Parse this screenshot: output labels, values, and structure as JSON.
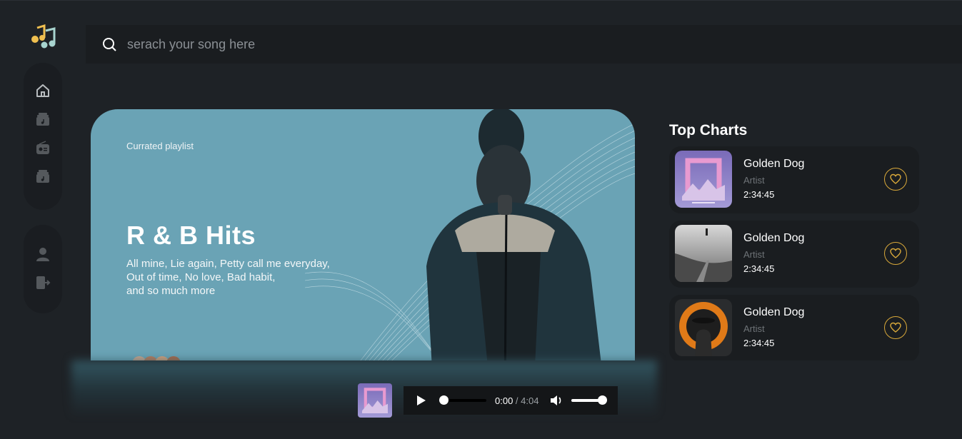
{
  "app": {
    "logo_icon": "music-notes-icon"
  },
  "search": {
    "placeholder": "serach your song here",
    "icon": "search-icon"
  },
  "sidebar": {
    "top_items": [
      {
        "icon": "home-icon"
      },
      {
        "icon": "music-library-icon"
      },
      {
        "icon": "radio-icon"
      },
      {
        "icon": "music-library-icon"
      }
    ],
    "bottom_items": [
      {
        "icon": "user-icon"
      },
      {
        "icon": "logout-icon"
      }
    ]
  },
  "hero": {
    "label": "Currated playlist",
    "title": "R & B Hits",
    "description_lines": [
      "All mine, Lie again, Petty call me everyday,",
      "Out of time, No love, Bad habit,",
      "and so much more"
    ]
  },
  "top_charts": {
    "title": "Top Charts",
    "items": [
      {
        "song": "Golden Dog",
        "artist": "Artist",
        "duration": "2:34:45"
      },
      {
        "song": "Golden Dog",
        "artist": "Artist",
        "duration": "2:34:45"
      },
      {
        "song": "Golden Dog",
        "artist": "Artist",
        "duration": "2:34:45"
      }
    ]
  },
  "player": {
    "current_time": "0:00",
    "separator": " / ",
    "total_time": "4:04",
    "progress": 0,
    "volume": 1.0
  },
  "colors": {
    "background": "#1e2226",
    "hero_bg": "#6aa3b5",
    "accent_gold": "#d9a93a",
    "card_bg": "#1a1d20"
  }
}
